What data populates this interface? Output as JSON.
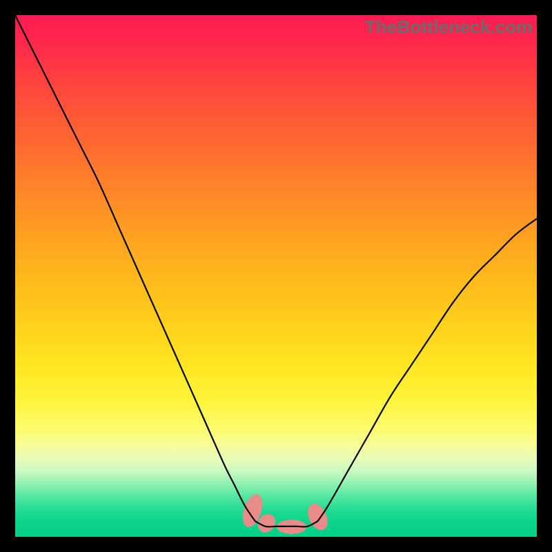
{
  "watermark": "TheBottleneck.com",
  "chart_data": {
    "type": "line",
    "title": "",
    "xlabel": "",
    "ylabel": "",
    "xlim": [
      0,
      100
    ],
    "ylim": [
      0,
      100
    ],
    "grid": false,
    "legend": false,
    "series": [
      {
        "name": "left-branch",
        "x": [
          0,
          4,
          8,
          12,
          16,
          20,
          24,
          28,
          32,
          36,
          40,
          42,
          44,
          46
        ],
        "y": [
          100,
          92,
          84,
          76,
          68,
          59,
          50,
          41,
          32,
          23,
          14,
          10,
          6,
          3
        ]
      },
      {
        "name": "right-branch",
        "x": [
          58,
          60,
          64,
          68,
          72,
          76,
          80,
          84,
          88,
          92,
          96,
          100
        ],
        "y": [
          3,
          6,
          13,
          20,
          27,
          33,
          39,
          45,
          50,
          54,
          58,
          61
        ]
      },
      {
        "name": "valley-floor",
        "x": [
          46,
          48,
          50,
          52,
          54,
          56,
          58
        ],
        "y": [
          3,
          2,
          2,
          2,
          2,
          2,
          3
        ]
      }
    ],
    "annotations": [
      {
        "name": "left-blob-tall",
        "x": 45.5,
        "y": 5.0,
        "shape": "ellipse",
        "rx": 1.6,
        "ry": 3.2,
        "angle": 18
      },
      {
        "name": "left-blob-short",
        "x": 48.2,
        "y": 2.6,
        "shape": "ellipse",
        "rx": 1.5,
        "ry": 1.8,
        "angle": 38
      },
      {
        "name": "mid-blob",
        "x": 53.0,
        "y": 1.9,
        "shape": "ellipse",
        "rx": 2.8,
        "ry": 1.3,
        "angle": 0
      },
      {
        "name": "right-blob",
        "x": 58.0,
        "y": 3.8,
        "shape": "ellipse",
        "rx": 1.6,
        "ry": 2.6,
        "angle": -25
      }
    ],
    "background_gradient_stops": [
      {
        "pos": 0,
        "color": "#ff1a52"
      },
      {
        "pos": 0.5,
        "color": "#ffb81c"
      },
      {
        "pos": 0.8,
        "color": "#fdfb6a"
      },
      {
        "pos": 1.0,
        "color": "#03d086"
      }
    ]
  },
  "colors": {
    "curve": "#000000",
    "blob": "#e98b89",
    "frame": "#000000",
    "watermark": "#6b6b6b"
  }
}
